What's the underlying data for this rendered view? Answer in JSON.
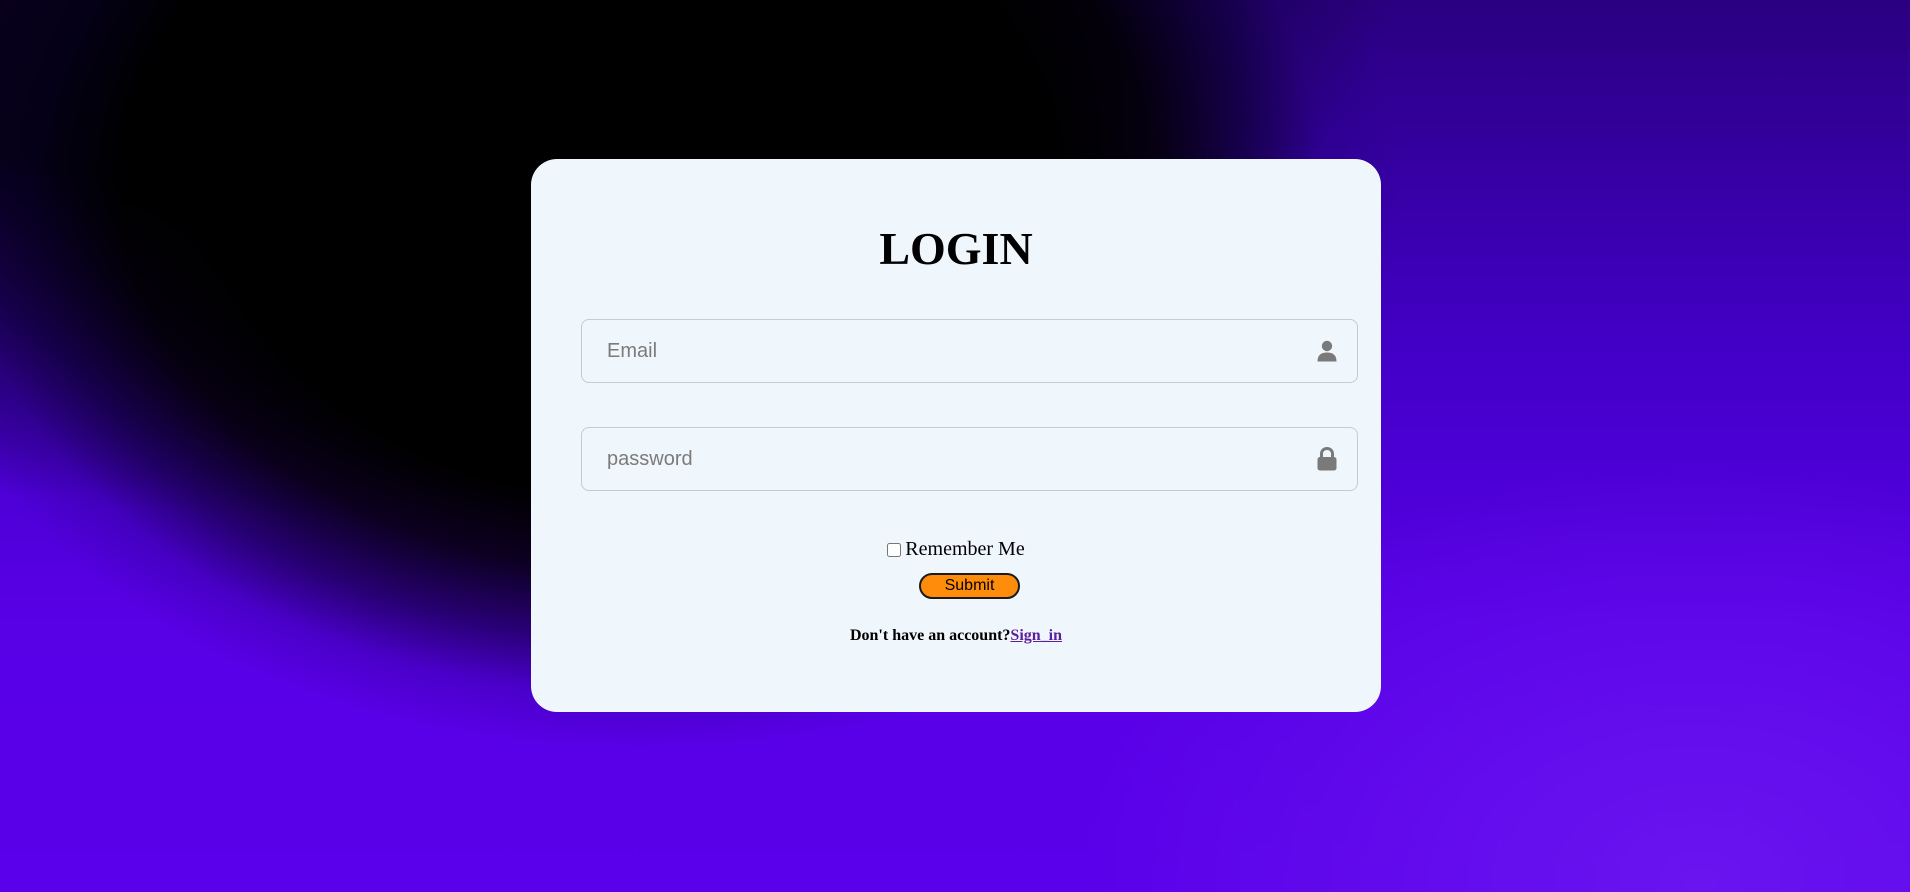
{
  "login": {
    "title": "LOGIN",
    "email_placeholder": "Email",
    "password_placeholder": "password",
    "remember_label": "Remember Me",
    "remember_checked": false,
    "submit_label": "Submit",
    "signup_prompt": "Don't have an account?",
    "signup_link": "Sign_in"
  },
  "icons": {
    "email": "user-icon",
    "password": "lock-icon"
  },
  "colors": {
    "card_background": "#eff6fc",
    "submit_background": "#ff8c0a",
    "link": "#5b1e9c",
    "background_dark": "#000000",
    "background_purple": "#5a00e8"
  }
}
